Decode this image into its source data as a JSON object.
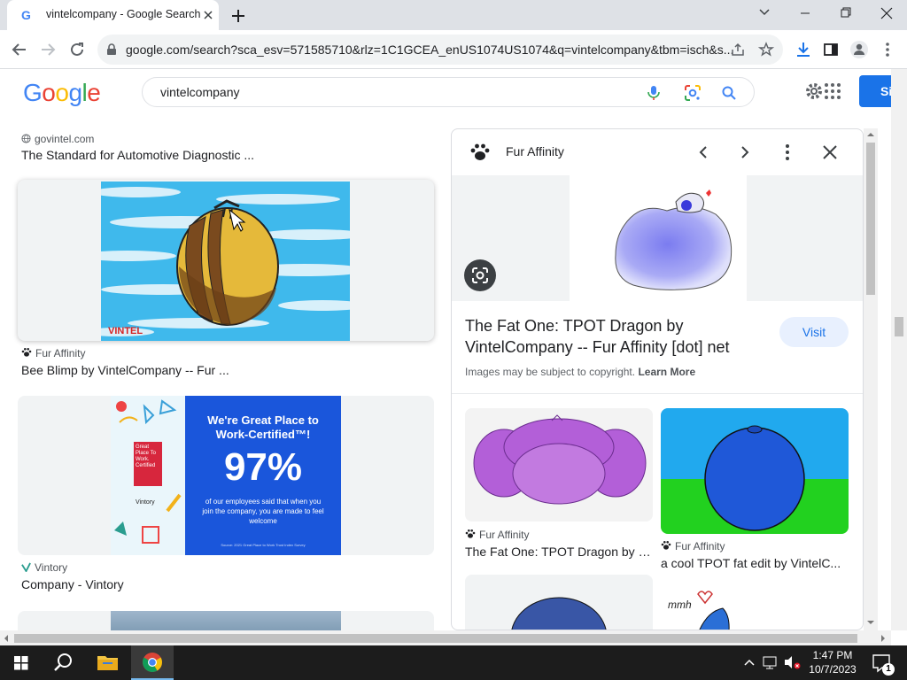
{
  "browser": {
    "tab_title": "vintelcompany - Google Search",
    "url": "google.com/search?sca_esv=571585710&rlz=1C1GCEA_enUS1074US1074&q=vintelcompany&tbm=isch&s..."
  },
  "google": {
    "logo": [
      "G",
      "o",
      "o",
      "g",
      "l",
      "e"
    ],
    "logo_colors": [
      "#4285F4",
      "#EA4335",
      "#FBBC05",
      "#4285F4",
      "#34A853",
      "#EA4335"
    ],
    "query": "vintelcompany",
    "signin_label": "Si"
  },
  "results": [
    {
      "source": "govintel.com",
      "title": "The Standard for Automotive Diagnostic ..."
    },
    {
      "source": "Fur Affinity",
      "title": "Bee Blimp by VintelCompany -- Fur ...",
      "image_text": "VINTEL"
    },
    {
      "source": "Vintory",
      "title": "Company - Vintory",
      "ad": {
        "headline": "We're Great  Place to Work-Certified™!",
        "percent": "97%",
        "body": "of our employees said that when you join the company, you are made to feel welcome",
        "footnote": "Source: 2021 Great Place to Work Trust Index Survey",
        "badge": "Great Place To Work. Certified",
        "brand": "Vintory"
      }
    }
  ],
  "panel": {
    "source": "Fur Affinity",
    "title": "The Fat One: TPOT Dragon by VintelCompany -- Fur Affinity [dot] net",
    "visit_label": "Visit",
    "copyright": "Images may be subject to copyright.",
    "learn_more": "Learn More",
    "related": [
      {
        "source": "Fur Affinity",
        "title": "The Fat One: TPOT Dragon by V..."
      },
      {
        "source": "Fur Affinity",
        "title": "a cool TPOT fat edit by VintelC..."
      },
      {
        "image_text": "mmh"
      }
    ]
  },
  "taskbar": {
    "time": "1:47 PM",
    "date": "10/7/2023",
    "notification_count": "1"
  },
  "colors": {
    "accent": "#1a73e8",
    "chrome_bg": "#dee1e6",
    "taskbar_bg": "#1c1c1c"
  }
}
